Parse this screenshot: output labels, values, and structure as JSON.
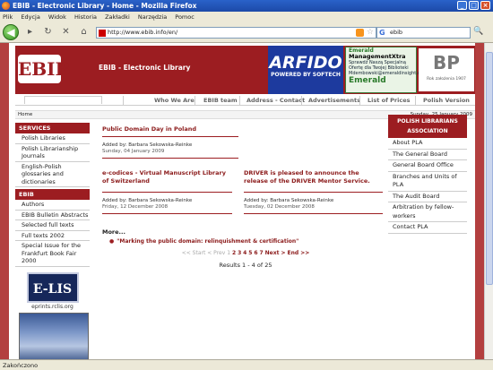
{
  "window": {
    "title": "EBIB - Electronic Library - Home - Mozilla Firefox"
  },
  "menu": [
    "Plik",
    "Edycja",
    "Widok",
    "Historia",
    "Zakładki",
    "Narzędzia",
    "Pomoc"
  ],
  "nav": {
    "url": "http://www.ebib.info/en/",
    "search_value": "ebib"
  },
  "status": "Zakończono",
  "site": {
    "logo": "EBIB",
    "title": "EBIB - Electronic Library",
    "ads": {
      "arfido_big": "ARFIDO",
      "arfido_small": "POWERED BY SOFTECH",
      "emerald_top": "Emerald",
      "emerald_product": "ManagementXtra",
      "emerald_line1": "Sprawdź Naszą Specjalną",
      "emerald_line2": "Ofertę dla Twojej Biblioteki",
      "emerald_mail": "Mdembowski@emeraldinsight.com",
      "emerald_bottom": "Emerald",
      "bp_logo": "BP",
      "bp_caption": "Rok założenia 1907"
    }
  },
  "tabs": [
    "Who We Are",
    "EBIB team",
    "Address - Contact",
    "Advertisements",
    "List of Prices",
    "Polish Version"
  ],
  "crumb": "Home",
  "date": "Sunday, 25 January 2009",
  "left": {
    "services_head": "SERVICES",
    "services": [
      "Polish Libraries",
      "Polish Librarianship Journals",
      "English-Polish glossaries and dictionaries"
    ],
    "ebib_head": "EBIB",
    "ebib": [
      "Authors",
      "EBIB Bulletin Abstracts",
      "Selected full texts",
      "Full texts 2002",
      "Special Issue for the Frankfurt Book Fair 2000"
    ],
    "elis_logo": "E-LIS",
    "elis_caption": "eprints.rclis.org"
  },
  "articles": [
    {
      "title": "Public Domain Day in Poland",
      "added": "Added by: Barbara Sekowska-Reinke",
      "date": "Sunday, 04 January 2009"
    },
    {
      "title": "e-codices - Virtual Manuscript Library of Switzerland",
      "added": "Added by: Barbara Sekowska-Reinke",
      "date": "Friday, 12 December 2008"
    },
    {
      "title": "DRIVER is pleased to announce the release of the DRIVER Mentor Service.",
      "added": "Added by: Barbara Sekowska-Reinke",
      "date": "Tuesday, 02 December 2008"
    }
  ],
  "more": {
    "label": "More...",
    "item": "\"Marking the public domain: relinquishment & certification\""
  },
  "pager": {
    "start": "<< Start",
    "prev": "< Prev",
    "current": "1",
    "pages": [
      "2",
      "3",
      "4",
      "5",
      "6",
      "7"
    ],
    "next": "Next >",
    "end": "End >>"
  },
  "results": "Results 1 - 4 of 25",
  "right": {
    "head": "POLISH LIBRARIANS ASSOCIATION",
    "items": [
      "About PLA",
      "The General Board",
      "General Board Office",
      "Branches and Units of PLA",
      "The Audit Board",
      "Arbitration by fellow-workers",
      "Contact PLA"
    ]
  }
}
